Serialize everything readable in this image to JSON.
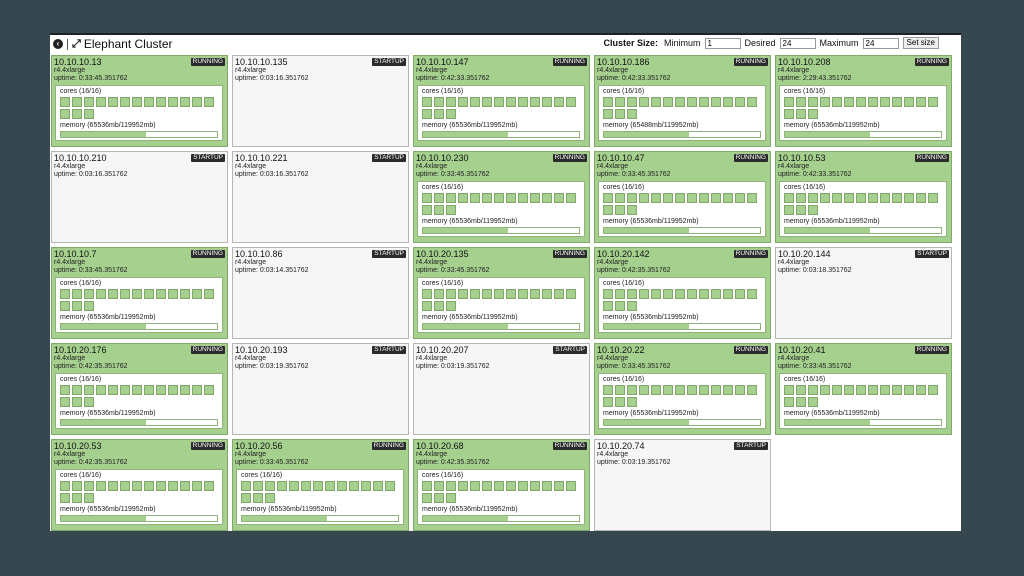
{
  "header": {
    "title": "Elephant Cluster",
    "cluster_size_label": "Cluster Size:",
    "minimum_label": "Minimum",
    "minimum_value": "1",
    "desired_label": "Desired",
    "desired_value": "24",
    "maximum_label": "Maximum",
    "maximum_value": "24",
    "set_size_label": "Set size"
  },
  "colors": {
    "running_bg": "#a5d08e",
    "startup_bg": "#f6f6f6",
    "badge_bg": "#2b2b2b",
    "page_bg": "#37474f"
  },
  "nodes": [
    {
      "ip": "10.10.10.13",
      "type": "r4.4xlarge",
      "uptime": "uptime: 0:33:45.351762",
      "status": "RUNNING",
      "cores_label": "cores (16/16)",
      "cores_used": 16,
      "memory_label": "memory (65536mb/119952mb)",
      "memory_fraction": 0.546
    },
    {
      "ip": "10.10.10.135",
      "type": "r4.4xlarge",
      "uptime": "uptime: 0:03:16.351762",
      "status": "STARTUP"
    },
    {
      "ip": "10.10.10.147",
      "type": "r4.4xlarge",
      "uptime": "uptime: 0:42:33.351762",
      "status": "RUNNING",
      "cores_label": "cores (16/16)",
      "cores_used": 16,
      "memory_label": "memory (65536mb/119952mb)",
      "memory_fraction": 0.546
    },
    {
      "ip": "10.10.10.186",
      "type": "r4.4xlarge",
      "uptime": "uptime: 0:42:33.351762",
      "status": "RUNNING",
      "cores_label": "cores (16/16)",
      "cores_used": 16,
      "memory_label": "memory (65488mb/119952mb)",
      "memory_fraction": 0.546
    },
    {
      "ip": "10.10.10.208",
      "type": "r4.4xlarge",
      "uptime": "uptime: 2:29:43.351762",
      "status": "RUNNING",
      "cores_label": "cores (16/16)",
      "cores_used": 16,
      "memory_label": "memory (65536mb/119952mb)",
      "memory_fraction": 0.546
    },
    {
      "ip": "10.10.10.210",
      "type": "r4.4xlarge",
      "uptime": "uptime: 0:03:16.351762",
      "status": "STARTUP"
    },
    {
      "ip": "10.10.10.221",
      "type": "r4.4xlarge",
      "uptime": "uptime: 0:03:16.351762",
      "status": "STARTUP"
    },
    {
      "ip": "10.10.10.230",
      "type": "r4.4xlarge",
      "uptime": "uptime: 0:33:45.351762",
      "status": "RUNNING",
      "cores_label": "cores (16/16)",
      "cores_used": 16,
      "memory_label": "memory (65536mb/119952mb)",
      "memory_fraction": 0.546
    },
    {
      "ip": "10.10.10.47",
      "type": "r4.4xlarge",
      "uptime": "uptime: 0:33:45.351762",
      "status": "RUNNING",
      "cores_label": "cores (16/16)",
      "cores_used": 16,
      "memory_label": "memory (65536mb/119952mb)",
      "memory_fraction": 0.546
    },
    {
      "ip": "10.10.10.53",
      "type": "r4.4xlarge",
      "uptime": "uptime: 0:42:33.351762",
      "status": "RUNNING",
      "cores_label": "cores (16/16)",
      "cores_used": 16,
      "memory_label": "memory (65536mb/119952mb)",
      "memory_fraction": 0.546
    },
    {
      "ip": "10.10.10.7",
      "type": "r4.4xlarge",
      "uptime": "uptime: 0:33:45.351762",
      "status": "RUNNING",
      "cores_label": "cores (16/16)",
      "cores_used": 16,
      "memory_label": "memory (65536mb/119952mb)",
      "memory_fraction": 0.546
    },
    {
      "ip": "10.10.10.86",
      "type": "r4.4xlarge",
      "uptime": "uptime: 0:03:14.351762",
      "status": "STARTUP"
    },
    {
      "ip": "10.10.20.135",
      "type": "r4.4xlarge",
      "uptime": "uptime: 0:33:45.351762",
      "status": "RUNNING",
      "cores_label": "cores (16/16)",
      "cores_used": 16,
      "memory_label": "memory (65536mb/119952mb)",
      "memory_fraction": 0.546
    },
    {
      "ip": "10.10.20.142",
      "type": "r4.4xlarge",
      "uptime": "uptime: 0:42:35.351762",
      "status": "RUNNING",
      "cores_label": "cores (16/16)",
      "cores_used": 16,
      "memory_label": "memory (65536mb/119952mb)",
      "memory_fraction": 0.546
    },
    {
      "ip": "10.10.20.144",
      "type": "r4.4xlarge",
      "uptime": "uptime: 0:03:18.351762",
      "status": "STARTUP"
    },
    {
      "ip": "10.10.20.176",
      "type": "r4.4xlarge",
      "uptime": "uptime: 0:42:35.351762",
      "status": "RUNNING",
      "cores_label": "cores (16/16)",
      "cores_used": 16,
      "memory_label": "memory (65536mb/119952mb)",
      "memory_fraction": 0.546
    },
    {
      "ip": "10.10.20.193",
      "type": "r4.4xlarge",
      "uptime": "uptime: 0:03:19.351762",
      "status": "STARTUP"
    },
    {
      "ip": "10.10.20.207",
      "type": "r4.4xlarge",
      "uptime": "uptime: 0:03:19.351762",
      "status": "STARTUP"
    },
    {
      "ip": "10.10.20.22",
      "type": "r4.4xlarge",
      "uptime": "uptime: 0:33:45.351762",
      "status": "RUNNING",
      "cores_label": "cores (16/16)",
      "cores_used": 16,
      "memory_label": "memory (65536mb/119952mb)",
      "memory_fraction": 0.546
    },
    {
      "ip": "10.10.20.41",
      "type": "r4.4xlarge",
      "uptime": "uptime: 0:33:45.351762",
      "status": "RUNNING",
      "cores_label": "cores (16/16)",
      "cores_used": 16,
      "memory_label": "memory (65536mb/119952mb)",
      "memory_fraction": 0.546
    },
    {
      "ip": "10.10.20.53",
      "type": "r4.4xlarge",
      "uptime": "uptime: 0:42:35.351762",
      "status": "RUNNING",
      "cores_label": "cores (16/16)",
      "cores_used": 16,
      "memory_label": "memory (65536mb/119952mb)",
      "memory_fraction": 0.546
    },
    {
      "ip": "10.10.20.56",
      "type": "r4.4xlarge",
      "uptime": "uptime: 0:33:45.351762",
      "status": "RUNNING",
      "cores_label": "cores (16/16)",
      "cores_used": 16,
      "memory_label": "memory (65536mb/119952mb)",
      "memory_fraction": 0.546
    },
    {
      "ip": "10.10.20.68",
      "type": "r4.4xlarge",
      "uptime": "uptime: 0:42:35.351762",
      "status": "RUNNING",
      "cores_label": "cores (16/16)",
      "cores_used": 16,
      "memory_label": "memory (65536mb/119952mb)",
      "memory_fraction": 0.546
    },
    {
      "ip": "10.10.20.74",
      "type": "r4.4xlarge",
      "uptime": "uptime: 0:03:19.351762",
      "status": "STARTUP"
    }
  ]
}
